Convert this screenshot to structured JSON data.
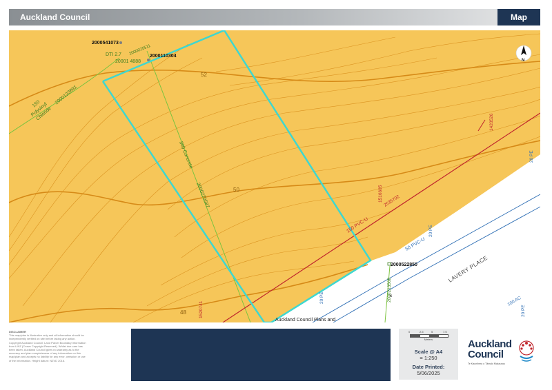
{
  "header": {
    "title": "Auckland Council",
    "tab_label": "Map"
  },
  "map": {
    "contour_labels": [
      "52",
      "50",
      "48"
    ],
    "point_ids": [
      "2000541073",
      "2000110304",
      "2000522850"
    ],
    "pipe_labels": {
      "dti": "DTI 2.7",
      "dti_id": "2000025511",
      "green_id": "20001 4888",
      "polyvinyl_size": "150",
      "polyvinyl_type": "Polyvinyl",
      "polyvinyl_type2": "Chloride",
      "polyvinyl_id": "2000123891",
      "concrete": "300 Concrete",
      "concrete_id": "2000270587",
      "pvc_main": "150 PVC-U",
      "pvc_id_a": "1516605",
      "pvc_id_b": "2535702",
      "pvc_id_c": "1420526",
      "red_id_lower": "1520741",
      "green_id_lower": "2000213568",
      "pe_20_a": "20 PE",
      "pe_20_b": "20 PE",
      "pe_20_c": "20 PE",
      "pe_50": "50 PVC-U",
      "ac_100": "100 AC",
      "pe_20_d": "20 PE"
    },
    "street_name": "LAVERY PLACE",
    "bottom_note": "Auckland Council Plans and",
    "north_label": "N",
    "colors": {
      "land": "#f6c659",
      "road": "#ffffff",
      "parcel": "#3fd7cf",
      "contour": "#d68a17",
      "sewer": "#c0272d",
      "storm": "#7cc33f",
      "water": "#2f6fb5"
    }
  },
  "footer": {
    "disclaimer_heading": "DISCLAIMER",
    "disclaimer_lines": [
      "This map/plan is illustrative only and all information should be",
      "independently verified on site before taking any action.",
      "Copyright Auckland Council.  Land Parcel Boundary information",
      "from LINZ (Crown Copyright Reserved). Whilst due care has",
      "been taken, Auckland Council gives no warranty as to the",
      "accuracy and plan completeness of any information on this",
      "map/plan and accepts no liability for any error, omission or use",
      "of the information. Height datum: NZVD 2016."
    ],
    "scale_ticks": [
      "0",
      "2.5",
      "5",
      "7.5"
    ],
    "scale_unit": "Meters",
    "scale_label": "Scale @ A4",
    "scale_value": "= 1:250",
    "date_label": "Date Printed:",
    "date_value": "5/06/2025",
    "logo_line1": "Auckland",
    "logo_line2": "Council",
    "logo_tagline": "Te Kaunihera o Tāmaki Makaurau"
  }
}
